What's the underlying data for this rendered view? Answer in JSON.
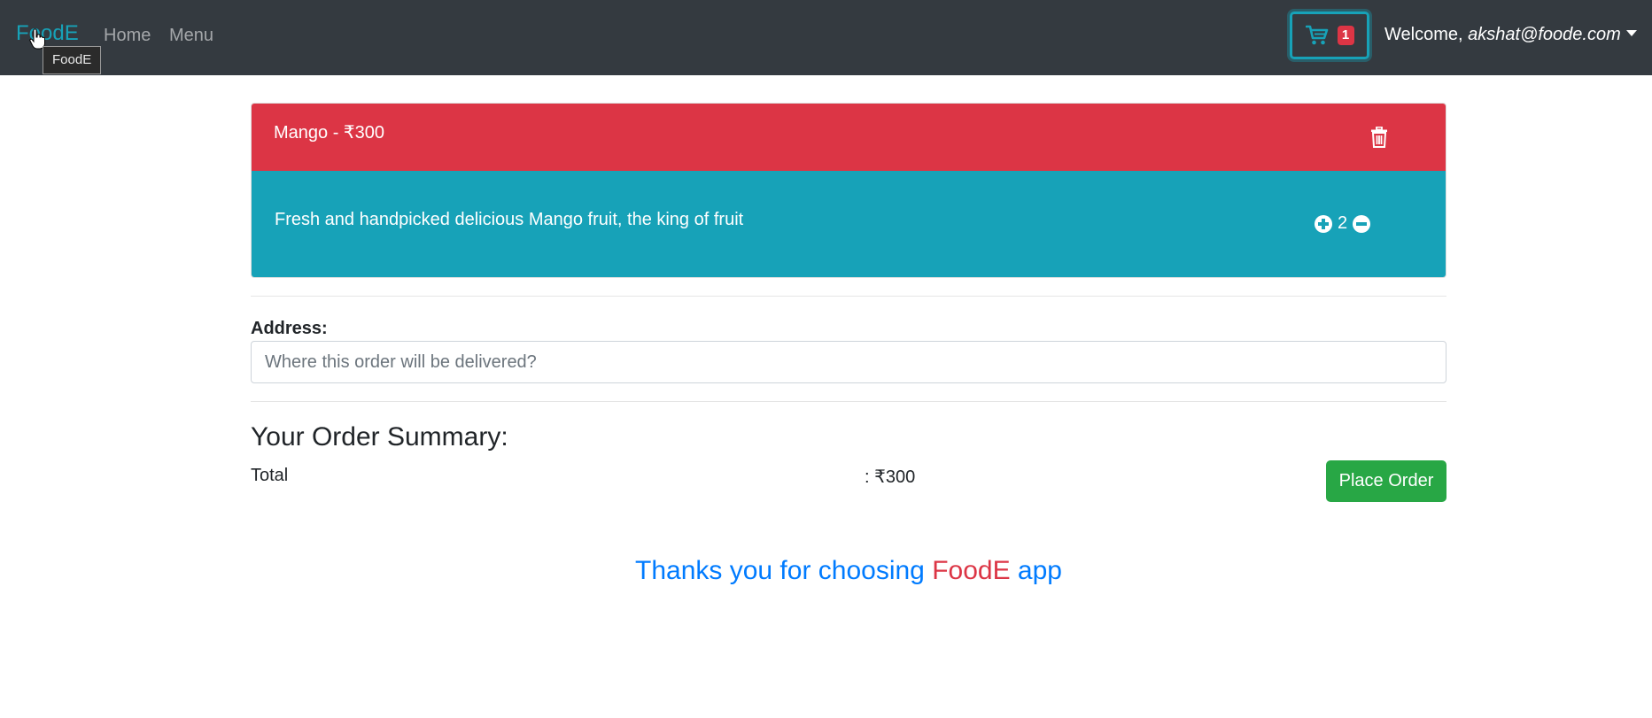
{
  "navbar": {
    "brand": "FoodE",
    "tooltip": "FoodE",
    "links": {
      "home": "Home",
      "menu": "Menu"
    },
    "cart_count": "1",
    "welcome_prefix": "Welcome, ",
    "user_email": "akshat@foode.com"
  },
  "cart_item": {
    "title": "Mango - ₹300",
    "description": "Fresh and handpicked delicious Mango fruit, the king of fruit",
    "quantity": "2"
  },
  "address": {
    "label": "Address:",
    "placeholder": "Where this order will be delivered?",
    "value": ""
  },
  "summary": {
    "title": "Your Order Summary:",
    "total_label": "Total",
    "total_value": ": ₹300",
    "place_order_label": "Place Order"
  },
  "footer": {
    "thanks_prefix": "Thanks you for choosing ",
    "thanks_brand": "FoodE",
    "thanks_suffix": " app"
  },
  "colors": {
    "navbar_bg": "#343a40",
    "header_red": "#dc3545",
    "body_teal": "#17a2b8",
    "success_green": "#28a745",
    "primary_blue": "#007bff"
  },
  "icons": {
    "cart": "shopping-cart-icon",
    "trash": "trash-icon",
    "plus": "plus-circle-icon",
    "minus": "minus-circle-icon",
    "dropdown": "caret-down-icon",
    "cursor": "hand-pointer-cursor-icon"
  }
}
